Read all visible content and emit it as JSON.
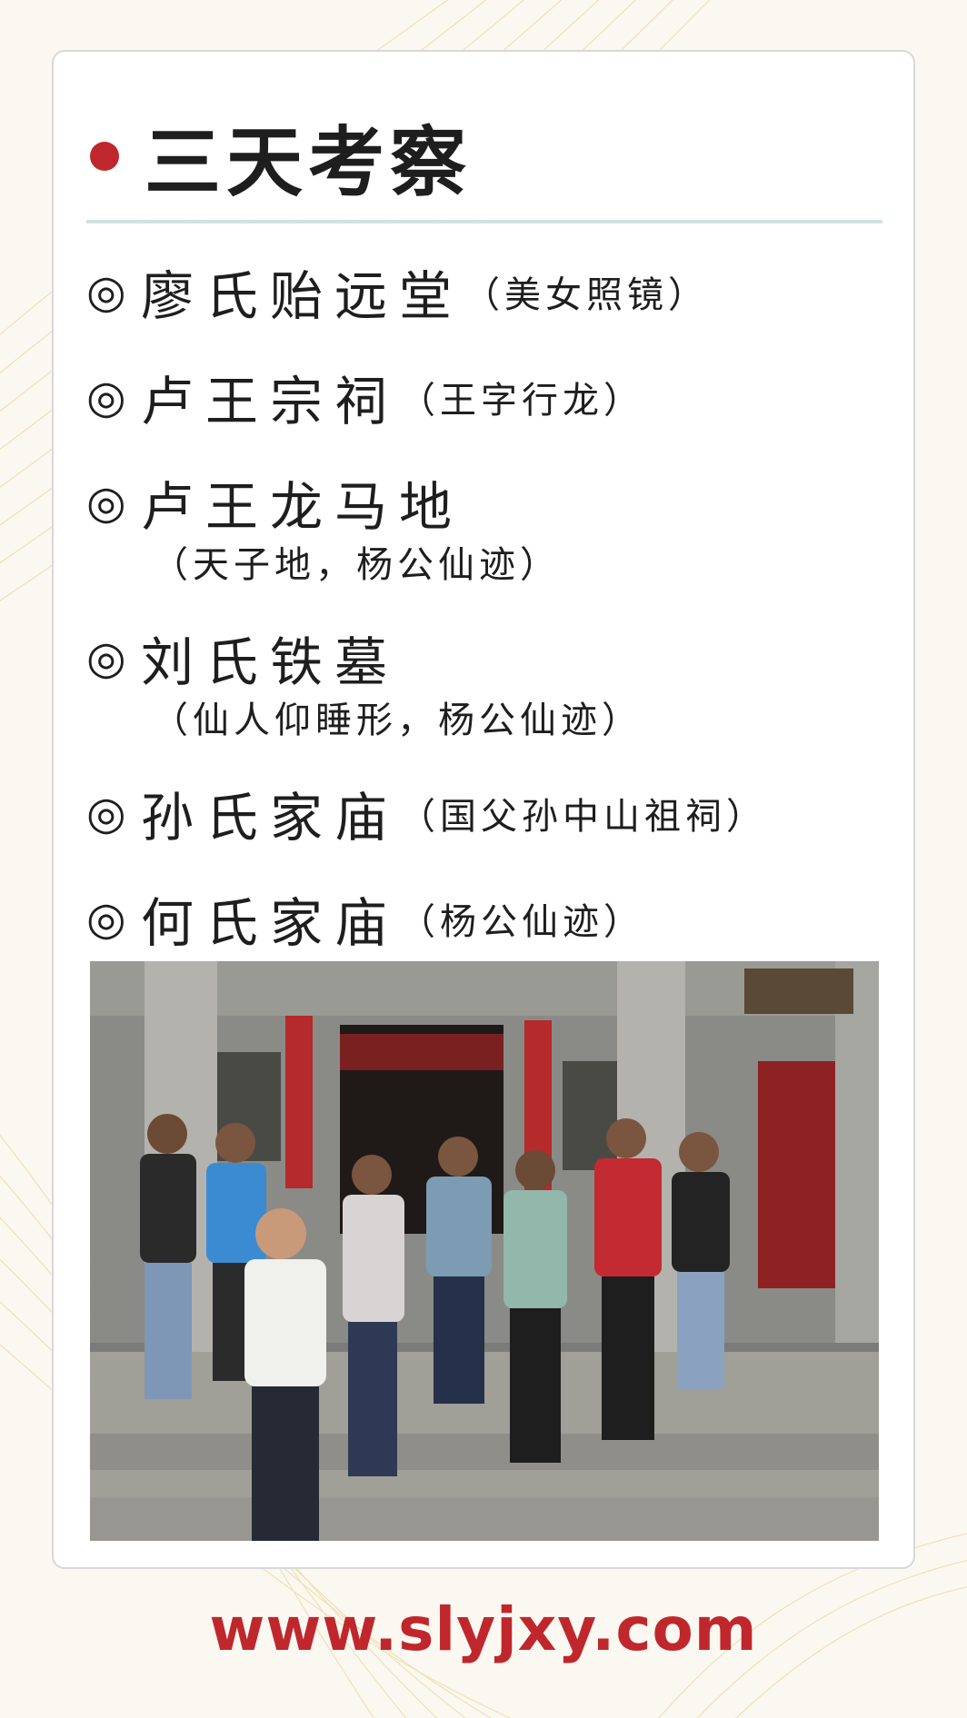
{
  "title": "三天考察",
  "items": [
    {
      "marker": "◎",
      "name": "廖氏贻远堂",
      "note": "（美女照镜）"
    },
    {
      "marker": "◎",
      "name": "卢王宗祠",
      "note": "（王字行龙）"
    },
    {
      "marker": "◎",
      "name": "卢王龙马地",
      "note": "（天子地，杨公仙迹）"
    },
    {
      "marker": "◎",
      "name": "刘氏铁墓",
      "note": "（仙人仰睡形，杨公仙迹）"
    },
    {
      "marker": "◎",
      "name": "孙氏家庙",
      "note": "（国父孙中山祖祠）"
    },
    {
      "marker": "◎",
      "name": "何氏家庙",
      "note": "（杨公仙迹）"
    }
  ],
  "website": "www.slyjxy.com",
  "colors": {
    "accent_red": "#c0272d",
    "divider": "#d2e2e2",
    "text": "#1e1e1e"
  },
  "photo": {
    "description_icon": "group-photo-at-ancestral-temple"
  }
}
